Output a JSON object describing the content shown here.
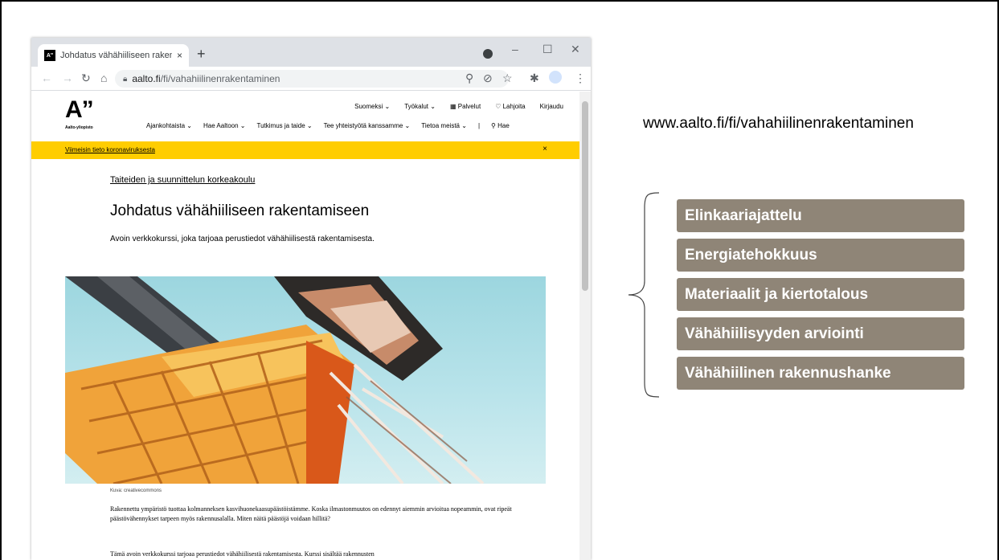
{
  "browser": {
    "tab_title": "Johdatus vähähiiliseen rakentam",
    "favicon_text": "A\"",
    "new_tab": "+",
    "tab_close": "×",
    "url_host": "aalto.fi",
    "url_path": "/fi/vahahiilinenrakentaminen",
    "minimize": "–",
    "maximize": "☐",
    "close": "✕"
  },
  "site": {
    "logo": "A”",
    "logo_sub": "Aalto-yliopisto",
    "top_links": [
      "Suomeksi",
      "Työkalut",
      "Palvelut",
      "Lahjoita",
      "Kirjaudu"
    ],
    "nav": [
      "Ajankohtaista",
      "Hae Aaltoon",
      "Tutkimus ja taide",
      "Tee yhteistyötä kanssamme",
      "Tietoa meistä"
    ],
    "search": "Hae",
    "alert_link": "Viimeisin tieto koronaviruksesta",
    "alert_close": "×",
    "breadcrumb": "Taiteiden ja suunnittelun korkeakoulu",
    "title": "Johdatus vähähiiliseen rakentamiseen",
    "lead": "Avoin verkkokurssi, joka tarjoaa perustiedot vähähiilisestä rakentamisesta.",
    "caption": "Kuva: creativecommons",
    "body1": "Rakennettu ympäristö tuottaa kolmanneksen kasvihuonekaasupäästöistämme. Koska ilmastonmuutos on edennyt aiemmin arvioitua nopeammin, ovat ripeät päästövähennykset tarpeen myös rakennusalalla. Miten näitä päästöjä voidaan hillitä?",
    "body2": "Tämä avoin verkkokurssi tarjoaa perustiedot vähähiilisestä rakentamisesta. Kurssi sisältää rakennusten"
  },
  "slide": {
    "url": "www.aalto.fi/fi/vahahiilinenrakentaminen",
    "topics": [
      "Elinkaariajattelu",
      "Energiatehokkuus",
      "Materiaalit ja kiertotalous",
      "Vähähiilisyyden arviointi",
      "Vähähiilinen rakennushanke"
    ]
  },
  "colors": {
    "alert": "#ffcd00",
    "topic_box": "#8f8577"
  },
  "icons": [
    "back-icon",
    "forward-icon",
    "reload-icon",
    "home-icon",
    "lock-icon",
    "zoom-icon",
    "eye-off-icon",
    "star-icon",
    "extensions-icon",
    "profile-icon",
    "menu-icon",
    "grid-icon",
    "heart-icon",
    "search-icon"
  ]
}
